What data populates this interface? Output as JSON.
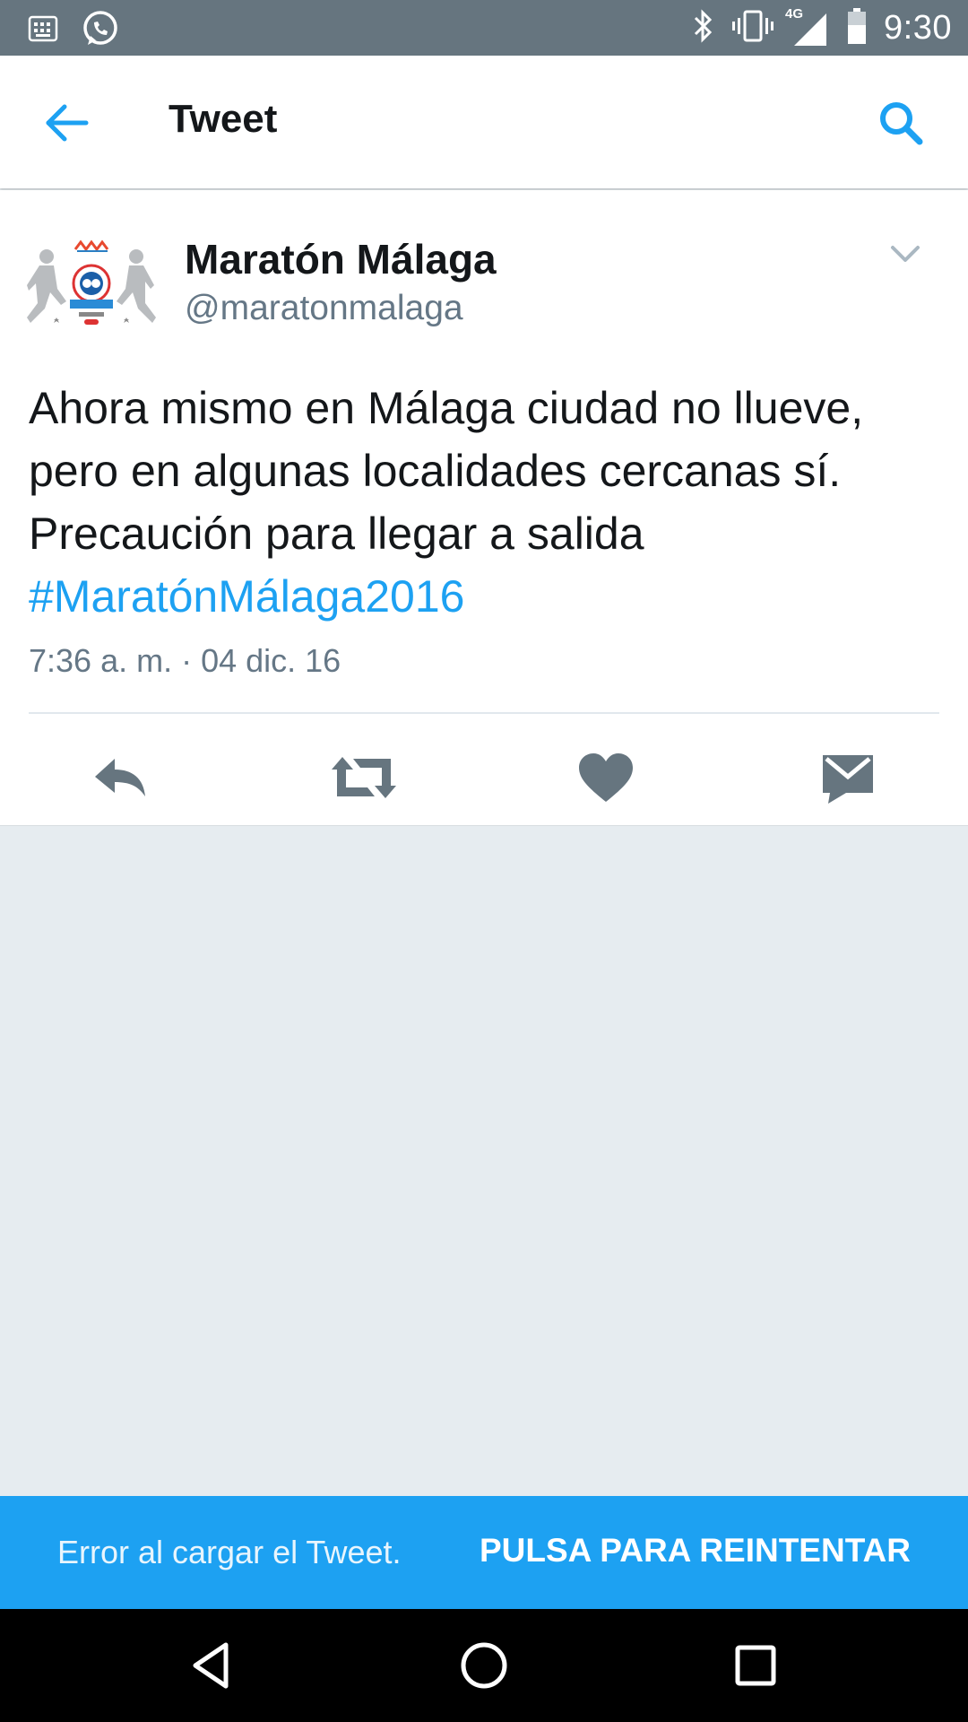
{
  "status_bar": {
    "time": "9:30",
    "network": "4G",
    "left_icons": [
      "keyboard-icon",
      "whatsapp-icon"
    ],
    "right_icons": [
      "bluetooth-icon",
      "vibrate-icon",
      "signal-icon",
      "battery-icon"
    ]
  },
  "toolbar": {
    "title": "Tweet",
    "back_icon": "arrow-left-icon",
    "search_icon": "search-icon"
  },
  "tweet": {
    "author_name": "Maratón Málaga",
    "author_handle": "@maratonmalaga",
    "text": "Ahora mismo en Málaga ciudad no llueve, pero en algunas localidades cercanas sí. Precaución para llegar a salida",
    "hashtag": "#MaratónMálaga2016",
    "timestamp": "7:36 a. m. · 04 dic. 16",
    "actions": [
      "reply-icon",
      "retweet-icon",
      "heart-icon",
      "message-icon"
    ]
  },
  "snackbar": {
    "message": "Error al cargar el Tweet.",
    "action_label": "PULSA PARA REINTENTAR"
  },
  "colors": {
    "status_bar": "#66757f",
    "accent": "#1da1f2",
    "icon_gray": "#66757f",
    "background": "#e6ecf0"
  }
}
